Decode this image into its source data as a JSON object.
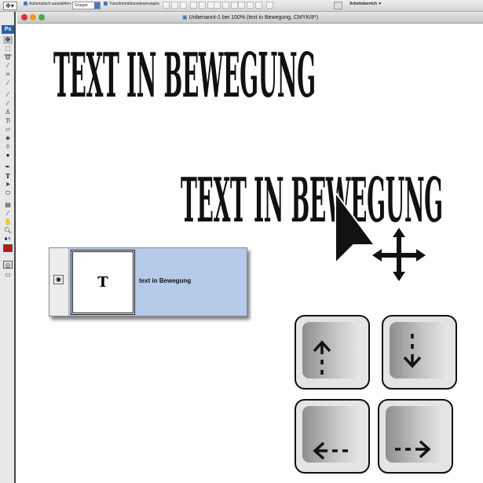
{
  "options_bar": {
    "tool": "move-tool",
    "auto_select_label": "Automatisch auswählen:",
    "auto_select_value": "Gruppe",
    "transform_label": "Transformationssteuerungen",
    "workspace_label": "Arbeitsbereich ▼"
  },
  "window": {
    "title": "Unbenannt-1 bei 100% (text in Bewegung, CMYK/8*)"
  },
  "tools": {
    "logo": "Ps",
    "foreground_color": "#c0161b"
  },
  "canvas": {
    "text_top": "TEXT IN BEWEGUNG",
    "text_moved": "TEXT IN BEWEGUNG"
  },
  "layer": {
    "thumb_label": "T",
    "name": "text in Bewegung"
  },
  "keys": [
    {
      "name": "up"
    },
    {
      "name": "down"
    },
    {
      "name": "left"
    },
    {
      "name": "right"
    }
  ]
}
